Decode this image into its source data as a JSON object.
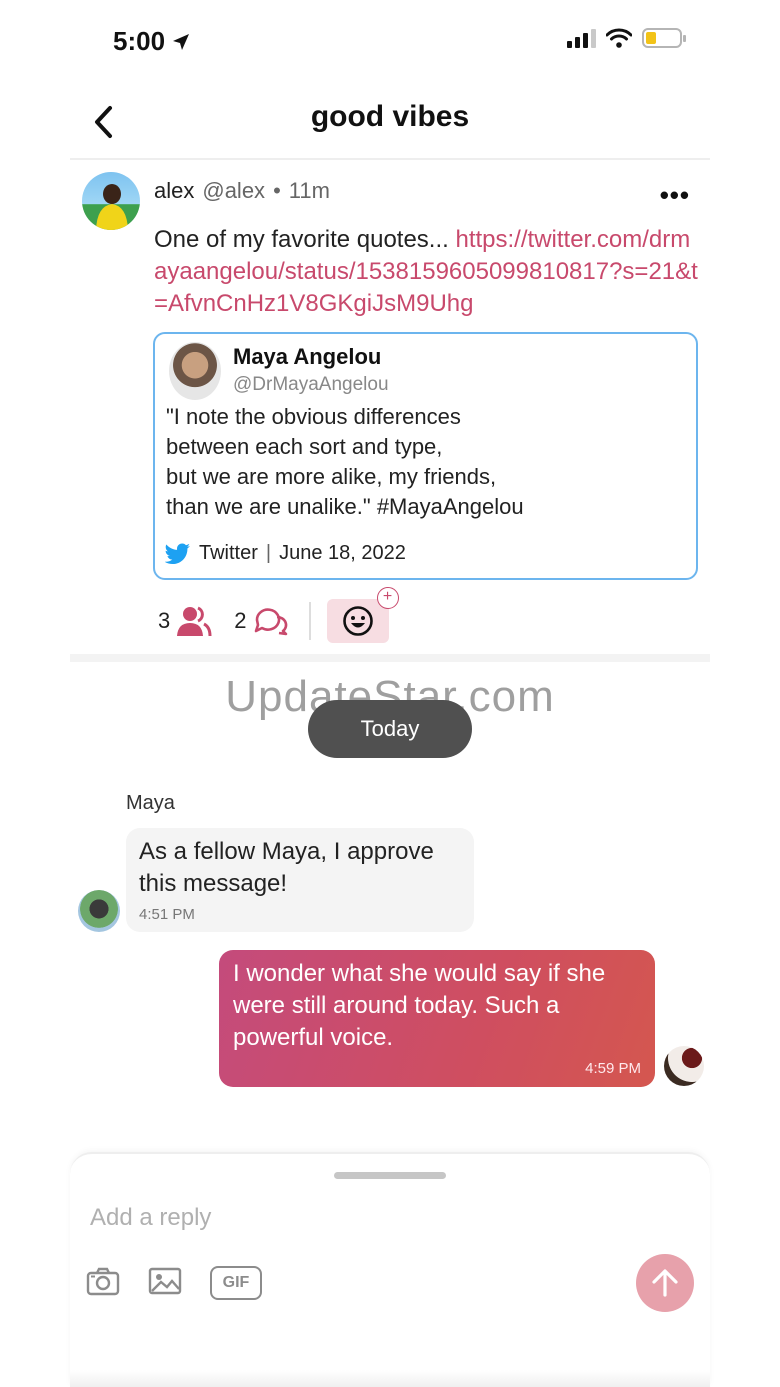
{
  "status_bar": {
    "time": "5:00"
  },
  "header": {
    "title": "good vibes"
  },
  "post": {
    "author_name": "alex",
    "author_handle": "@alex",
    "separator": "•",
    "time_ago": "11m",
    "more_label": "•••",
    "text_prefix": "One of my favorite quotes... ",
    "link": "https://twitter.com/drmayaangelou/status/1538159605099810817?s=21&t=AfvnCnHz1V8GKgiJsM9Uhg",
    "tweet": {
      "name": "Maya Angelou",
      "handle": "@DrMayaAngelou",
      "lines": [
        "\"I note the obvious differences",
        "between each sort and type,",
        "but we are more alike, my friends,",
        "than we are unalike.\" #MayaAngelou"
      ],
      "source": "Twitter",
      "separator": "|",
      "date": "June 18, 2022"
    },
    "actions": {
      "members_count": "3",
      "comments_count": "2",
      "plus": "+"
    }
  },
  "watermark": "UpdateStar.com",
  "chat": {
    "date_label": "Today",
    "incoming": {
      "sender": "Maya",
      "text": "As a fellow Maya, I approve this message!",
      "time": "4:51 PM"
    },
    "outgoing": {
      "text": "I wonder what she would say if she were still around today. Such a powerful voice.",
      "time": "4:59 PM"
    }
  },
  "reply": {
    "placeholder": "Add a reply",
    "gif_label": "GIF"
  },
  "colors": {
    "accent": "#c8496c",
    "link": "#c8496c",
    "tweet_border": "#6cb5ee",
    "twitter_blue": "#1da1f2",
    "send_button": "#e7a1ab"
  }
}
